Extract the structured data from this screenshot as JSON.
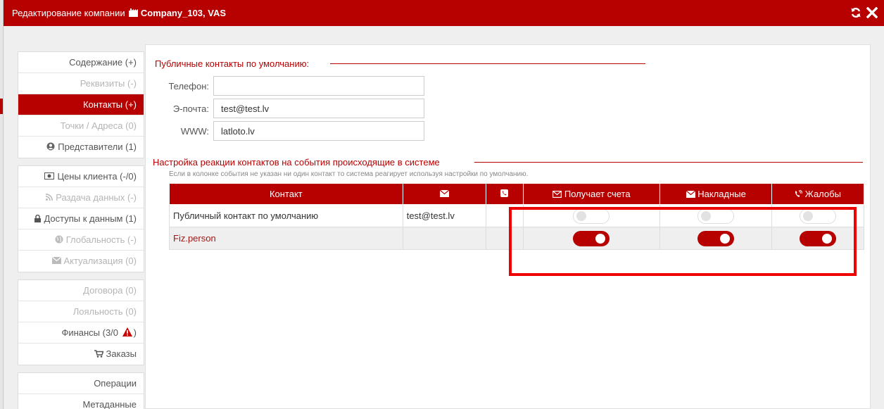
{
  "window": {
    "title": "Редактирование компании",
    "company": "Company_103, VAS"
  },
  "sidebar": {
    "groups": [
      [
        {
          "label": "Содержание (+)",
          "icon": "",
          "state": "normal"
        },
        {
          "label": "Реквизиты (-)",
          "icon": "",
          "state": "dim"
        },
        {
          "label": "Контакты (+)",
          "icon": "",
          "state": "active"
        },
        {
          "label": "Точки / Адреса (0)",
          "icon": "",
          "state": "dim"
        },
        {
          "label": "Представители (1)",
          "icon": "user-circle-icon",
          "state": "normal"
        }
      ],
      [
        {
          "label": "Цены клиента (-/0)",
          "icon": "money-icon",
          "state": "normal"
        },
        {
          "label": "Раздача данных (-)",
          "icon": "rss-icon",
          "state": "dim"
        },
        {
          "label": "Доступы к данным (1)",
          "icon": "lock-icon",
          "state": "normal"
        },
        {
          "label": "Глобальность (-)",
          "icon": "globe-icon",
          "state": "dim"
        },
        {
          "label": "Актуализация (0)",
          "icon": "envelope-icon",
          "state": "dim"
        }
      ],
      [
        {
          "label": "Договора (0)",
          "icon": "",
          "state": "dim"
        },
        {
          "label": "Лояльность (0)",
          "icon": "",
          "state": "dim"
        },
        {
          "label": "Финансы (3/0",
          "icon": "warning-icon",
          "suffix": ")",
          "state": "normal"
        },
        {
          "label": "Заказы",
          "icon": "cart-icon",
          "state": "normal"
        }
      ],
      [
        {
          "label": "Операции",
          "icon": "",
          "state": "normal"
        },
        {
          "label": "Метаданные",
          "icon": "",
          "state": "normal"
        }
      ]
    ]
  },
  "public_contacts": {
    "legend": "Публичные контакты по умолчанию:",
    "phone_label": "Телефон:",
    "phone_value": "",
    "email_label": "Э-почта:",
    "email_value": "test@test.lv",
    "www_label": "WWW:",
    "www_value": "latloto.lv"
  },
  "events": {
    "legend": "Настройка реакции контактов на события происходящие в системе",
    "hint": "Если в колонке события не указан ни один контакт то система реагирует используя настройки по умолчанию.",
    "headers": {
      "contact": "Контакт",
      "email_icon": "envelope-icon",
      "phone_icon": "phone-icon",
      "invoices": "Получает счета",
      "waybills": "Накладные",
      "complaints": "Жалобы"
    },
    "rows": [
      {
        "contact": "Публичный контакт по умолчанию",
        "email": "test@test.lv",
        "phone": "",
        "invoices": false,
        "waybills": false,
        "complaints": false,
        "link": false
      },
      {
        "contact": "Fiz.person",
        "email": "",
        "phone": "",
        "invoices": true,
        "waybills": true,
        "complaints": true,
        "link": true
      }
    ]
  },
  "colors": {
    "accent": "#b70000",
    "highlight": "#ee0000"
  }
}
